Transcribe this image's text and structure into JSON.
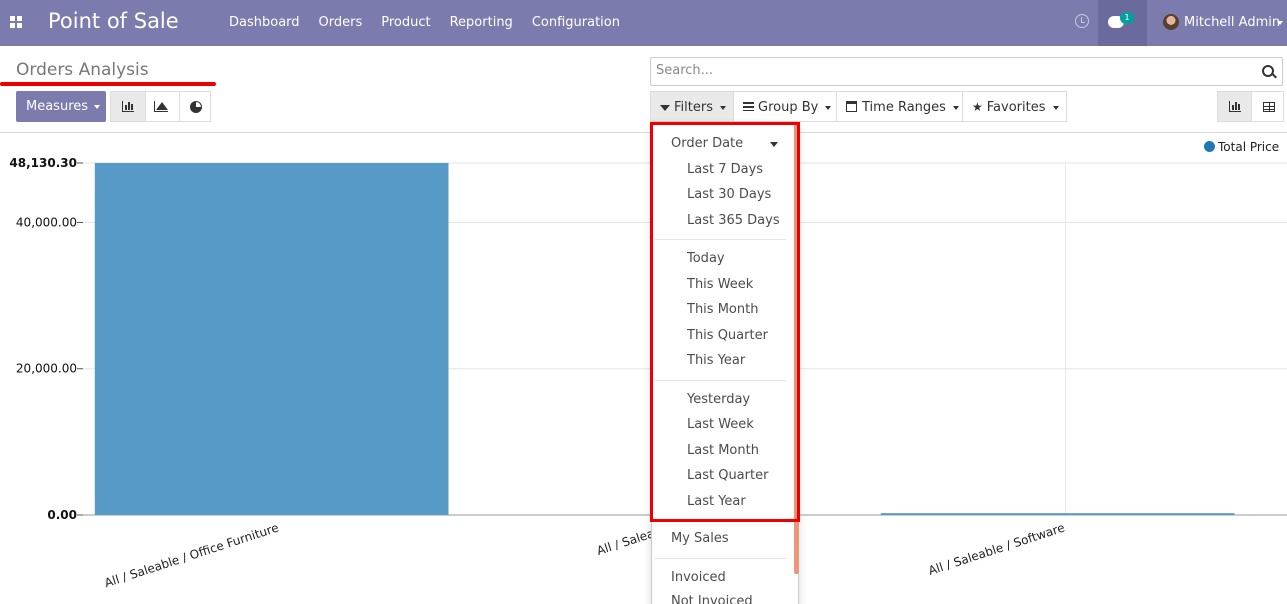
{
  "navbar": {
    "app_title": "Point of Sale",
    "menu": [
      "Dashboard",
      "Orders",
      "Product",
      "Reporting",
      "Configuration"
    ],
    "chat_badge": "1",
    "user_name": "Mitchell Admin"
  },
  "control_panel": {
    "title": "Orders Analysis",
    "search_placeholder": "Search...",
    "measures_label": "Measures",
    "filters_label": "Filters",
    "group_by_label": "Group By",
    "time_ranges_label": "Time Ranges",
    "favorites_label": "Favorites"
  },
  "filters_dropdown": {
    "order_date_label": "Order Date",
    "group1": [
      "Last 7 Days",
      "Last 30 Days",
      "Last 365 Days"
    ],
    "group2": [
      "Today",
      "This Week",
      "This Month",
      "This Quarter",
      "This Year"
    ],
    "group3": [
      "Yesterday",
      "Last Week",
      "Last Month",
      "Last Quarter",
      "Last Year"
    ],
    "my_sales": "My Sales",
    "invoiced": "Invoiced",
    "not_invoiced": "Not Invoiced"
  },
  "chart_data": {
    "type": "bar",
    "categories": [
      "All / Saleable / Office Furniture",
      "All / Saleable",
      "All / Saleable / Software"
    ],
    "series": [
      {
        "name": "Total Price",
        "values": [
          48130.3,
          0,
          250
        ]
      }
    ],
    "yticks": [
      "0.00",
      "20,000.00",
      "40,000.00",
      "48,130.30"
    ],
    "ylim": [
      0,
      48130.3
    ],
    "legend_position": "top-right",
    "colors": {
      "bar": "#5799c7",
      "legend": "#1f77b4"
    },
    "grid": true
  }
}
